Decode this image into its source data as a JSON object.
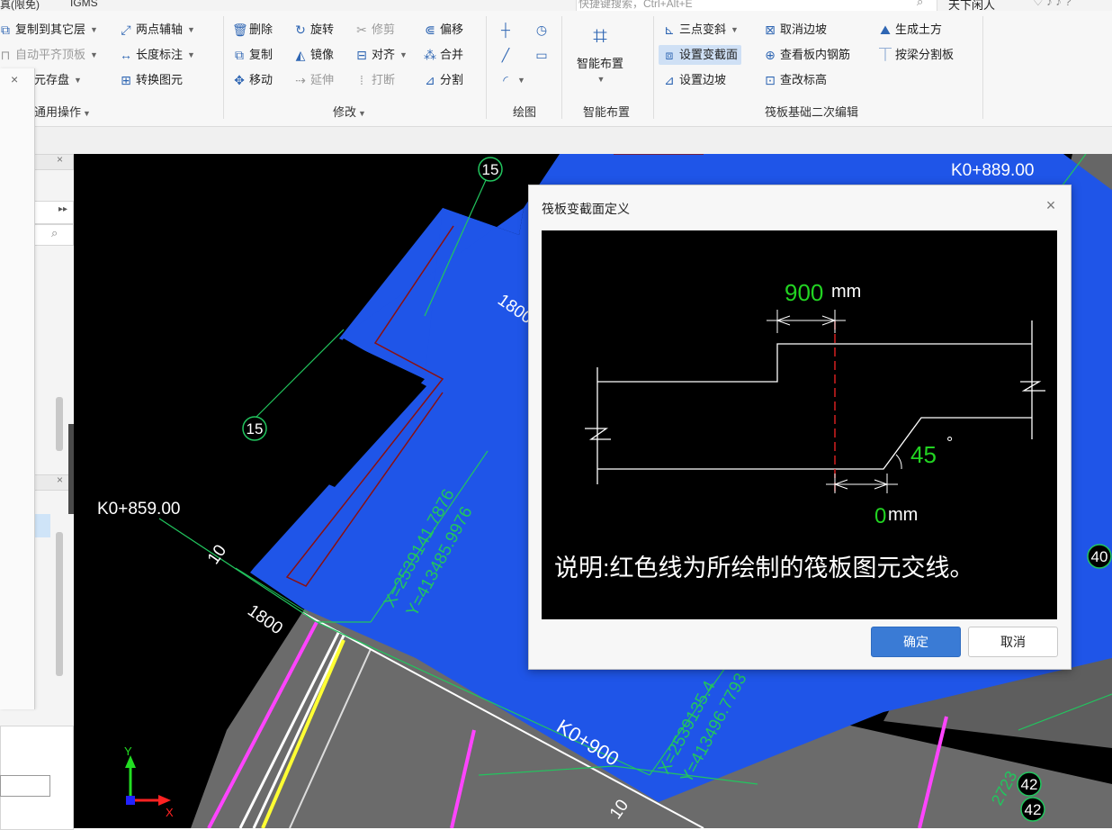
{
  "title_bar": {
    "left_text": "真(限免)",
    "app_name": "IGMS",
    "search_placeholder": "快捷键搜索，Ctrl+Alt+E",
    "user_name": "天下闲人"
  },
  "ribbon": {
    "groups": [
      {
        "label": "通用操作",
        "items": [
          "复制到其它层",
          "两点辅轴",
          "自动平齐顶板",
          "长度标注",
          "元存盘",
          "转换图元"
        ]
      },
      {
        "label": "修改",
        "items": [
          "删除",
          "旋转",
          "修剪",
          "偏移",
          "复制",
          "镜像",
          "对齐",
          "合并",
          "移动",
          "延伸",
          "打断",
          "分割"
        ]
      },
      {
        "label": "绘图",
        "items": []
      },
      {
        "label": "智能布置",
        "items": [
          "智能布置"
        ]
      },
      {
        "label": "筏板基础二次编辑",
        "items": [
          "三点变斜",
          "取消边坡",
          "生成土方",
          "设置变截面",
          "查看板内钢筋",
          "按梁分割板",
          "设置边坡",
          "查改标高"
        ]
      }
    ]
  },
  "canvas": {
    "labels": {
      "station_top_right": "K0+889.00",
      "station_left": "K0+859.00",
      "station_bottom": "K0+900",
      "axis_15_top": "15",
      "axis_15_left": "15",
      "axis_40": "40",
      "axis_42a": "42",
      "axis_42b": "42",
      "dim_1800_a": "1800",
      "dim_1800_b": "1800",
      "dim_10_a": "10",
      "dim_10_b": "10",
      "coord_x1": "X=2539141.7876",
      "coord_y1": "Y=413485.9976",
      "coord_x2": "X=2539135.4",
      "coord_y2": "Y=413496.7793",
      "num_2723": "2723",
      "axis_y": "Y",
      "axis_x": "X"
    }
  },
  "dialog": {
    "title": "筏板变截面定义",
    "figure": {
      "top_width_value": "900",
      "top_width_unit": "mm",
      "angle_value": "45",
      "angle_unit": "°",
      "bottom_offset_value": "0",
      "bottom_offset_unit": "mm",
      "note": "说明:红色线为所绘制的筏板图元交线。"
    },
    "ok_label": "确定",
    "cancel_label": "取消"
  },
  "colors": {
    "slab_blue": "#1f55e8",
    "cad_green": "#22c55e",
    "cad_red": "#d62020",
    "value_green": "#22d322",
    "accent_button": "#3a7bd5"
  }
}
